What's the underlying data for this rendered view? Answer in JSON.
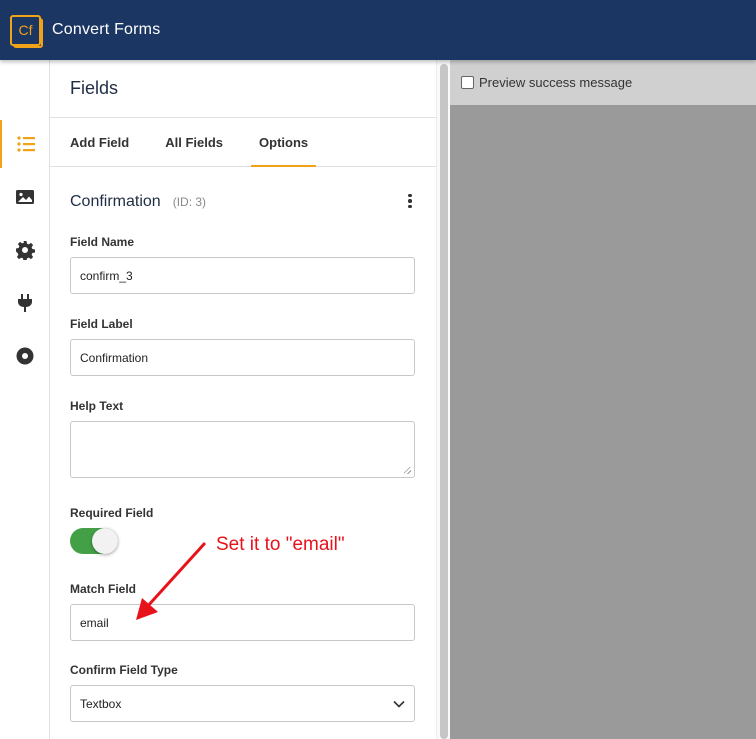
{
  "app": {
    "title": "Convert Forms",
    "logo_text": "Cf"
  },
  "sidebar": {
    "items": [
      {
        "name": "fields",
        "icon": "list-icon",
        "active": true
      },
      {
        "name": "design",
        "icon": "image-icon",
        "active": false
      },
      {
        "name": "settings",
        "icon": "gear-icon",
        "active": false
      },
      {
        "name": "integrations",
        "icon": "plug-icon",
        "active": false
      },
      {
        "name": "submissions",
        "icon": "circle-icon",
        "active": false
      }
    ]
  },
  "panel": {
    "title": "Fields",
    "tabs": [
      {
        "label": "Add Field",
        "active": false
      },
      {
        "label": "All Fields",
        "active": false
      },
      {
        "label": "Options",
        "active": true
      }
    ],
    "field": {
      "type_label": "Confirmation",
      "id_label": "(ID: 3)",
      "field_name": {
        "label": "Field Name",
        "value": "confirm_3"
      },
      "field_label": {
        "label": "Field Label",
        "value": "Confirmation"
      },
      "help_text": {
        "label": "Help Text",
        "value": ""
      },
      "required": {
        "label": "Required Field",
        "on": true
      },
      "match_field": {
        "label": "Match Field",
        "value": "email"
      },
      "confirm_type": {
        "label": "Confirm Field Type",
        "selected": "Textbox"
      }
    }
  },
  "preview": {
    "checkbox_label": "Preview success message",
    "checked": false
  },
  "annotation": {
    "text": "Set it to \"email\"",
    "color": "#e8121a"
  },
  "colors": {
    "topbar": "#1b3663",
    "accent": "#f0a318",
    "toggle_on": "#43a047"
  }
}
